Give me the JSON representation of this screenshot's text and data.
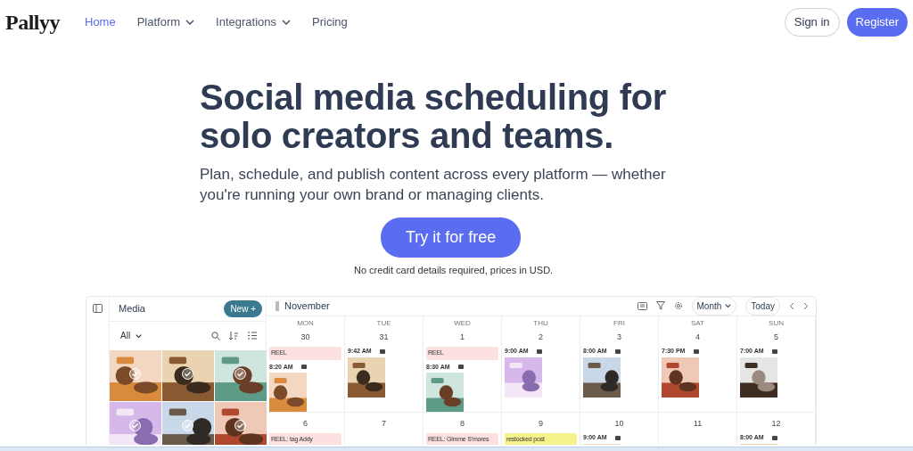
{
  "nav": {
    "logo": "Pallyy",
    "links": [
      {
        "label": "Home",
        "selected": true,
        "dropdown": false
      },
      {
        "label": "Platform",
        "selected": false,
        "dropdown": true
      },
      {
        "label": "Integrations",
        "selected": false,
        "dropdown": true
      },
      {
        "label": "Pricing",
        "selected": false,
        "dropdown": false
      }
    ],
    "sign_in": "Sign in",
    "register": "Register"
  },
  "hero": {
    "title_lines": [
      "Social media scheduling for",
      "solo creators and teams."
    ],
    "subtitle_lines": [
      "Plan, schedule, and publish content across every platform — whether",
      "you're running your own brand or managing clients."
    ],
    "cta": "Try it for free",
    "note": "No credit card details required, prices in USD."
  },
  "app": {
    "media": {
      "title": "Media",
      "new_button": "New +",
      "filter": "All"
    },
    "calendar": {
      "month": "November",
      "view": "Month",
      "today": "Today",
      "days": [
        "MON",
        "TUE",
        "WED",
        "THU",
        "FRI",
        "SAT",
        "SUN"
      ],
      "weeks": [
        [
          {
            "date": "30",
            "items": [
              {
                "kind": "label",
                "text": "REEL",
                "color": "#fde1e1"
              },
              {
                "kind": "post",
                "time": "8:20 AM"
              }
            ]
          },
          {
            "date": "31",
            "items": [
              {
                "kind": "post",
                "time": "9:42 AM"
              }
            ]
          },
          {
            "date": "1",
            "items": [
              {
                "kind": "label",
                "text": "REEL",
                "color": "#fde1e1"
              },
              {
                "kind": "post",
                "time": "8:30 AM"
              }
            ]
          },
          {
            "date": "2",
            "items": [
              {
                "kind": "post",
                "time": "9:00 AM"
              }
            ]
          },
          {
            "date": "3",
            "items": [
              {
                "kind": "post",
                "time": "8:00 AM"
              }
            ]
          },
          {
            "date": "4",
            "items": [
              {
                "kind": "post",
                "time": "7:30 PM"
              }
            ]
          },
          {
            "date": "5",
            "items": [
              {
                "kind": "post",
                "time": "7:00 AM"
              }
            ]
          }
        ],
        [
          {
            "date": "6",
            "items": [
              {
                "kind": "label",
                "text": "REEL: tag Addy",
                "color": "#fde1e1"
              }
            ]
          },
          {
            "date": "7"
          },
          {
            "date": "8",
            "items": [
              {
                "kind": "label",
                "text": "REEL: Gimme S'mores",
                "color": "#fde1e1"
              }
            ]
          },
          {
            "date": "9",
            "items": [
              {
                "kind": "label",
                "text": "restocked post",
                "color": "#f7f38c"
              }
            ]
          },
          {
            "date": "10",
            "items": [
              {
                "kind": "post",
                "time": "9:00 AM"
              }
            ]
          },
          {
            "date": "11"
          },
          {
            "date": "12",
            "items": [
              {
                "kind": "post",
                "time": "8:00 AM"
              }
            ]
          }
        ]
      ]
    }
  }
}
